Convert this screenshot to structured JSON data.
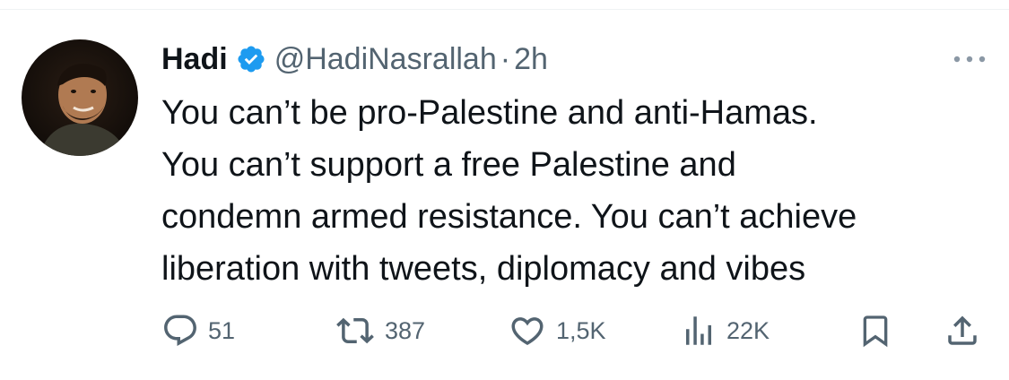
{
  "tweet": {
    "author_name": "Hadi",
    "handle": "@HadiNasrallah",
    "separator": "·",
    "time": "2h",
    "text": "You can’t be pro-Palestine and anti-Hamas.\nYou can’t support a free Palestine and\ncondemn armed resistance. You can’t achieve\nliberation with tweets, diplomacy and vibes",
    "verified": true
  },
  "actions": {
    "replies": "51",
    "reposts": "387",
    "likes": "1,5K",
    "views": "22K"
  },
  "icons": {
    "reply": "reply-icon",
    "repost": "repost-icon",
    "like": "heart-icon",
    "views": "views-icon",
    "bookmark": "bookmark-icon",
    "share": "share-icon",
    "more": "more-icon",
    "verified": "verified-badge-icon"
  },
  "colors": {
    "text": "#0f1419",
    "secondary": "#536471",
    "verified": "#1d9bf0",
    "divider": "#eff3f4"
  }
}
